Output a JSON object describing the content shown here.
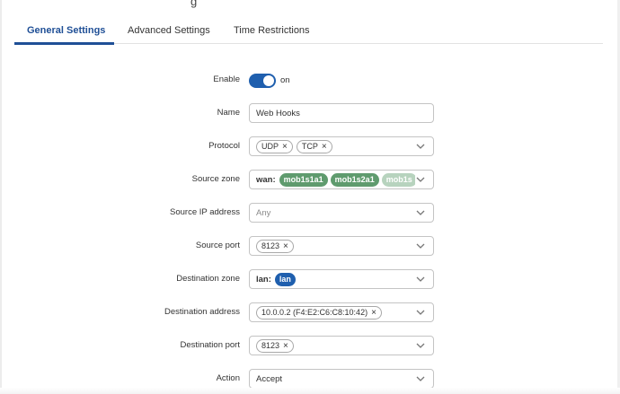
{
  "page": {
    "title_fragment": "g"
  },
  "tabs": [
    {
      "label": "General Settings",
      "active": true
    },
    {
      "label": "Advanced Settings",
      "active": false
    },
    {
      "label": "Time Restrictions",
      "active": false
    }
  ],
  "form": {
    "enable": {
      "label": "Enable",
      "state_text": "on",
      "checked": true
    },
    "name": {
      "label": "Name",
      "value": "Web Hooks"
    },
    "protocol": {
      "label": "Protocol",
      "chips": [
        "UDP",
        "TCP"
      ]
    },
    "source_zone": {
      "label": "Source zone",
      "prefix": "wan:",
      "zones": [
        "mob1s1a1",
        "mob1s2a1",
        "mob1s"
      ]
    },
    "source_ip": {
      "label": "Source IP address",
      "placeholder": "Any"
    },
    "source_port": {
      "label": "Source port",
      "chips": [
        "8123"
      ]
    },
    "destination_zone": {
      "label": "Destination zone",
      "prefix": "lan:",
      "zones": [
        "lan"
      ]
    },
    "destination_address": {
      "label": "Destination address",
      "chips": [
        "10.0.0.2 (F4:E2:C6:C8:10:42)"
      ]
    },
    "destination_port": {
      "label": "Destination port",
      "chips": [
        "8123"
      ]
    },
    "action": {
      "label": "Action",
      "value": "Accept"
    }
  },
  "icons": {
    "chevron": "chevron-down-icon",
    "remove": "close-icon"
  },
  "colors": {
    "accent": "#1f4f96",
    "toggle_on": "#1f5fae",
    "wan_zone": "#5f9b6e",
    "wan_zone_faded": "#b7d3be",
    "lan_zone": "#1f5fae",
    "chip_x": "×"
  }
}
